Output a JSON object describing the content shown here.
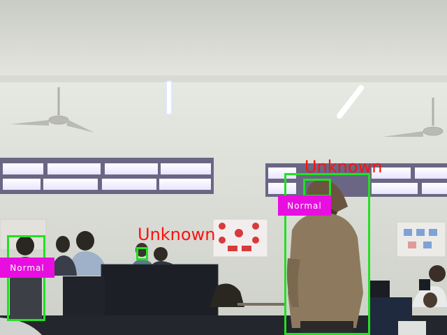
{
  "detections": [
    {
      "id": "person-left",
      "label": "",
      "status": "Normal"
    },
    {
      "id": "face-center",
      "label": "Unknown",
      "status": ""
    },
    {
      "id": "person-right",
      "label": "Unknown",
      "status": "Normal"
    }
  ],
  "colors": {
    "box": "#22e022",
    "label_text": "#ff1010",
    "status_bg": "#e80ee0",
    "status_text": "#ffffff"
  }
}
